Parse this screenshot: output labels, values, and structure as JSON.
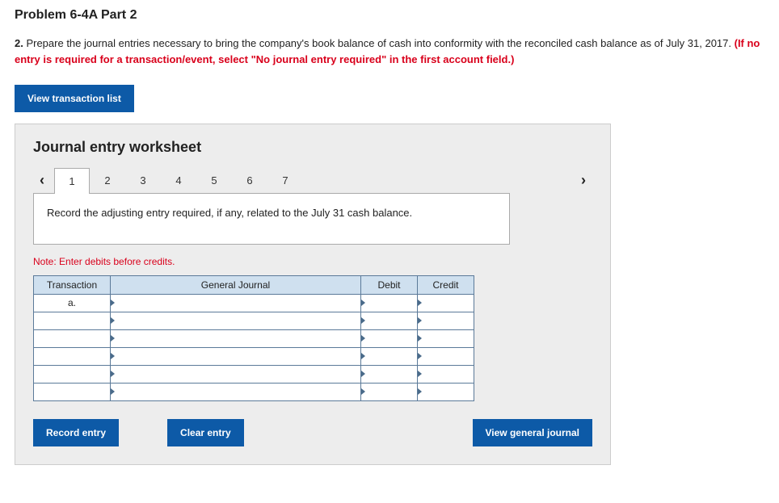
{
  "title": "Problem 6-4A Part 2",
  "instruction": {
    "num": "2.",
    "text": " Prepare the journal entries necessary to bring the company's book balance of cash into conformity with the reconciled cash balance as of July 31, 2017. ",
    "red": "(If no entry is required for a transaction/event, select \"No journal entry required\" in the first account field.)"
  },
  "buttons": {
    "view_list": "View transaction list",
    "record": "Record entry",
    "clear": "Clear entry",
    "view_journal": "View general journal"
  },
  "worksheet": {
    "heading": "Journal entry worksheet",
    "tabs": [
      "1",
      "2",
      "3",
      "4",
      "5",
      "6",
      "7"
    ],
    "active_tab": 0,
    "prompt": "Record the adjusting entry required, if any, related to the July 31 cash balance.",
    "note": "Note: Enter debits before credits.",
    "columns": {
      "transaction": "Transaction",
      "general_journal": "General Journal",
      "debit": "Debit",
      "credit": "Credit"
    },
    "rows": [
      {
        "trx": "a.",
        "gj": "",
        "debit": "",
        "credit": ""
      },
      {
        "trx": "",
        "gj": "",
        "debit": "",
        "credit": ""
      },
      {
        "trx": "",
        "gj": "",
        "debit": "",
        "credit": ""
      },
      {
        "trx": "",
        "gj": "",
        "debit": "",
        "credit": ""
      },
      {
        "trx": "",
        "gj": "",
        "debit": "",
        "credit": ""
      },
      {
        "trx": "",
        "gj": "",
        "debit": "",
        "credit": ""
      }
    ]
  }
}
